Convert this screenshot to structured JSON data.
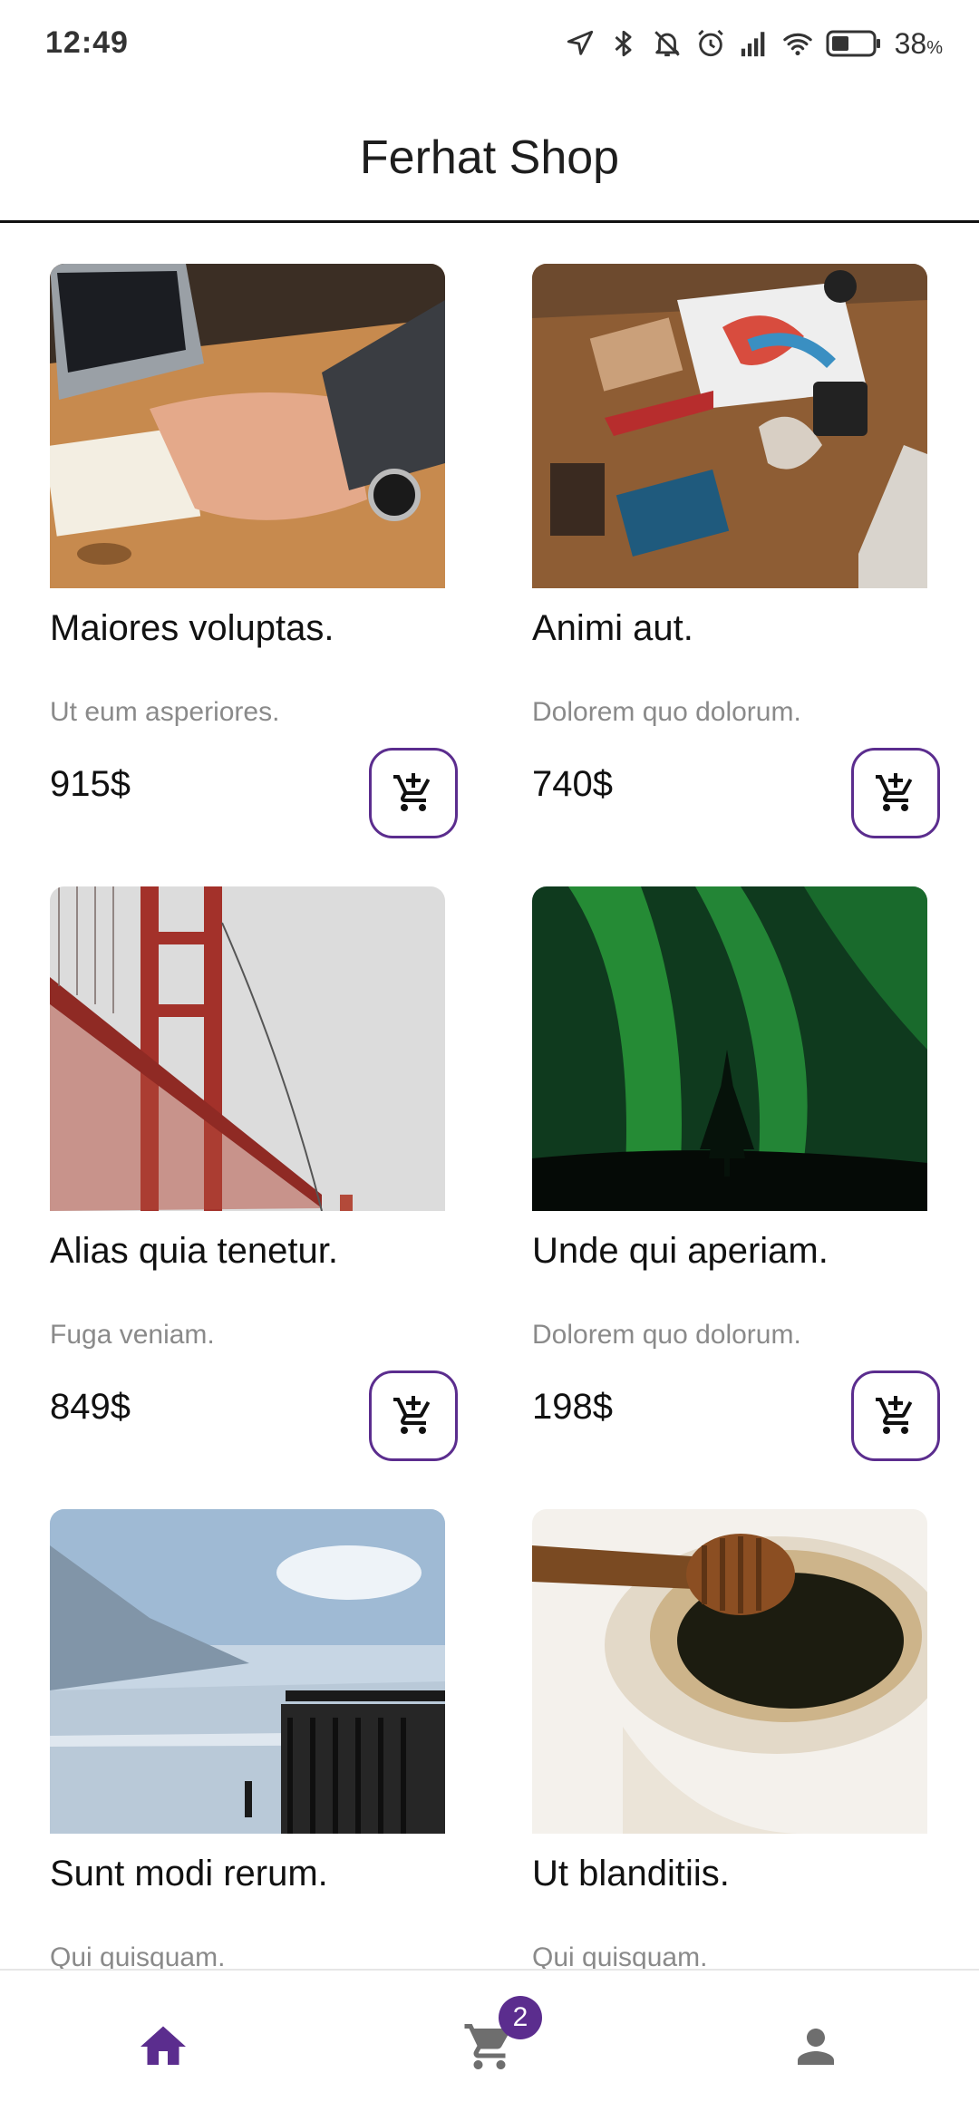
{
  "status_bar": {
    "time": "12:49",
    "battery_level": "38",
    "battery_unit": "%",
    "icons": [
      "location-icon",
      "bluetooth-icon",
      "mute-icon",
      "alarm-icon",
      "signal-icon",
      "wifi-icon",
      "battery-icon"
    ]
  },
  "app_bar": {
    "title": "Ferhat Shop"
  },
  "products": [
    {
      "title": "Maiores voluptas.",
      "subtitle": "Ut eum asperiores.",
      "price": "915$"
    },
    {
      "title": "Animi aut.",
      "subtitle": "Dolorem quo dolorum.",
      "price": "740$"
    },
    {
      "title": "Alias quia tenetur.",
      "subtitle": "Fuga veniam.",
      "price": "849$"
    },
    {
      "title": "Unde qui aperiam.",
      "subtitle": "Dolorem quo dolorum.",
      "price": "198$"
    },
    {
      "title": "Sunt modi rerum.",
      "subtitle": "Qui quisquam.",
      "price": ""
    },
    {
      "title": "Ut blanditiis.",
      "subtitle": "Qui quisquam.",
      "price": ""
    }
  ],
  "bottom_nav": {
    "items": [
      {
        "icon": "home-icon",
        "active": true
      },
      {
        "icon": "cart-icon",
        "active": false
      },
      {
        "icon": "person-icon",
        "active": false
      }
    ],
    "cart_badge": "2"
  },
  "colors": {
    "accent": "#5b2d8e",
    "inactive_icon": "#6e6e6e",
    "subtitle_text": "#8a8a8a"
  }
}
